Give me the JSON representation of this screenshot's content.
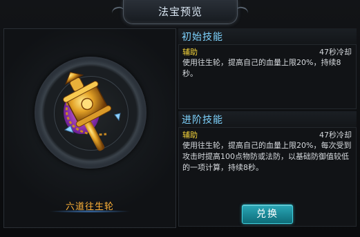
{
  "window": {
    "title": "法宝预览"
  },
  "artifact": {
    "name": "六道往生轮",
    "icon": "golden-prayer-wheel-icon"
  },
  "skills": {
    "initial": {
      "header": "初始技能",
      "type": "辅助",
      "cooldown": "47秒冷却",
      "description": "使用往生轮，提高自己的血量上限20%，持续8秒。"
    },
    "advanced": {
      "header": "进阶技能",
      "type": "辅助",
      "cooldown": "47秒冷却",
      "description": "使用往生轮，提高自己的血量上限20%，每次受到攻击时提高100点物防或法防，以基础防御值较低的一项计算，持续8秒。"
    }
  },
  "actions": {
    "exchange_label": "兑换"
  },
  "colors": {
    "section_header": "#7fd4ff",
    "skill_type": "#f3d23a",
    "artifact_name": "#ffb238",
    "button": "#1a8e9c"
  }
}
